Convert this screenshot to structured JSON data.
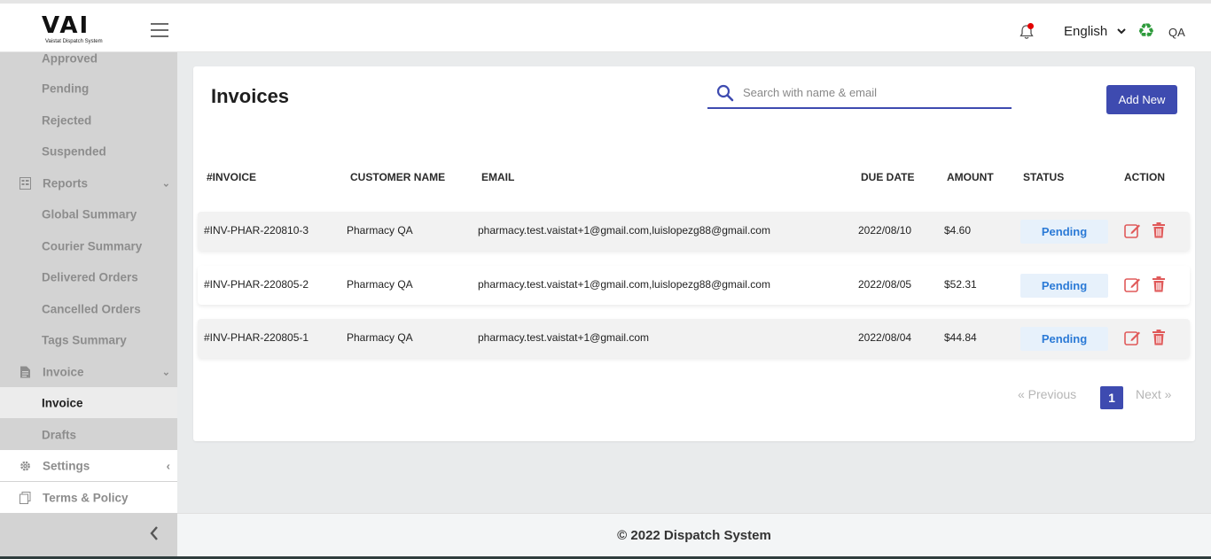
{
  "brand": {
    "logo_text": "VAI",
    "logo_subtitle": "Vaistat Dispatch System"
  },
  "header": {
    "language": "English",
    "user": "QA",
    "notification_dot_color": "#e30000"
  },
  "sidebar": {
    "items": [
      {
        "label": "Approved"
      },
      {
        "label": "Pending"
      },
      {
        "label": "Rejected"
      },
      {
        "label": "Suspended"
      },
      {
        "label": "Reports",
        "icon": "report-icon"
      },
      {
        "label": "Global Summary"
      },
      {
        "label": "Courier Summary"
      },
      {
        "label": "Delivered Orders"
      },
      {
        "label": "Cancelled Orders"
      },
      {
        "label": "Tags Summary"
      },
      {
        "label": "Invoice",
        "icon": "invoice-doc-icon"
      },
      {
        "label": "Invoice",
        "active": true
      },
      {
        "label": "Drafts"
      },
      {
        "label": "Settings",
        "icon": "gear-icon"
      },
      {
        "label": "Terms & Policy",
        "icon": "terms-icon"
      }
    ]
  },
  "main": {
    "title": "Invoices",
    "search_placeholder": "Search with name & email",
    "add_label": "Add New",
    "columns": [
      "#INVOICE",
      "CUSTOMER NAME",
      "EMAIL",
      "DUE DATE",
      "AMOUNT",
      "STATUS",
      "ACTION"
    ],
    "rows": [
      {
        "invoice": "#INV-PHAR-220810-3",
        "customer": "Pharmacy QA",
        "email": "pharmacy.test.vaistat+1@gmail.com,luislopezg88@gmail.com",
        "due": "2022/08/10",
        "amount": "$4.60",
        "status": "Pending"
      },
      {
        "invoice": "#INV-PHAR-220805-2",
        "customer": "Pharmacy QA",
        "email": "pharmacy.test.vaistat+1@gmail.com,luislopezg88@gmail.com",
        "due": "2022/08/05",
        "amount": "$52.31",
        "status": "Pending"
      },
      {
        "invoice": "#INV-PHAR-220805-1",
        "customer": "Pharmacy QA",
        "email": "pharmacy.test.vaistat+1@gmail.com",
        "due": "2022/08/04",
        "amount": "$44.84",
        "status": "Pending"
      }
    ],
    "pagination": {
      "prev": "« Previous",
      "current": "1",
      "next": "Next »"
    }
  },
  "footer": {
    "text": "© 2022 Dispatch System"
  },
  "colors": {
    "accent": "#3e4bb0",
    "status_text": "#2b7ad6",
    "status_bg": "#e7f1fb",
    "action_red": "#e05a5a"
  }
}
